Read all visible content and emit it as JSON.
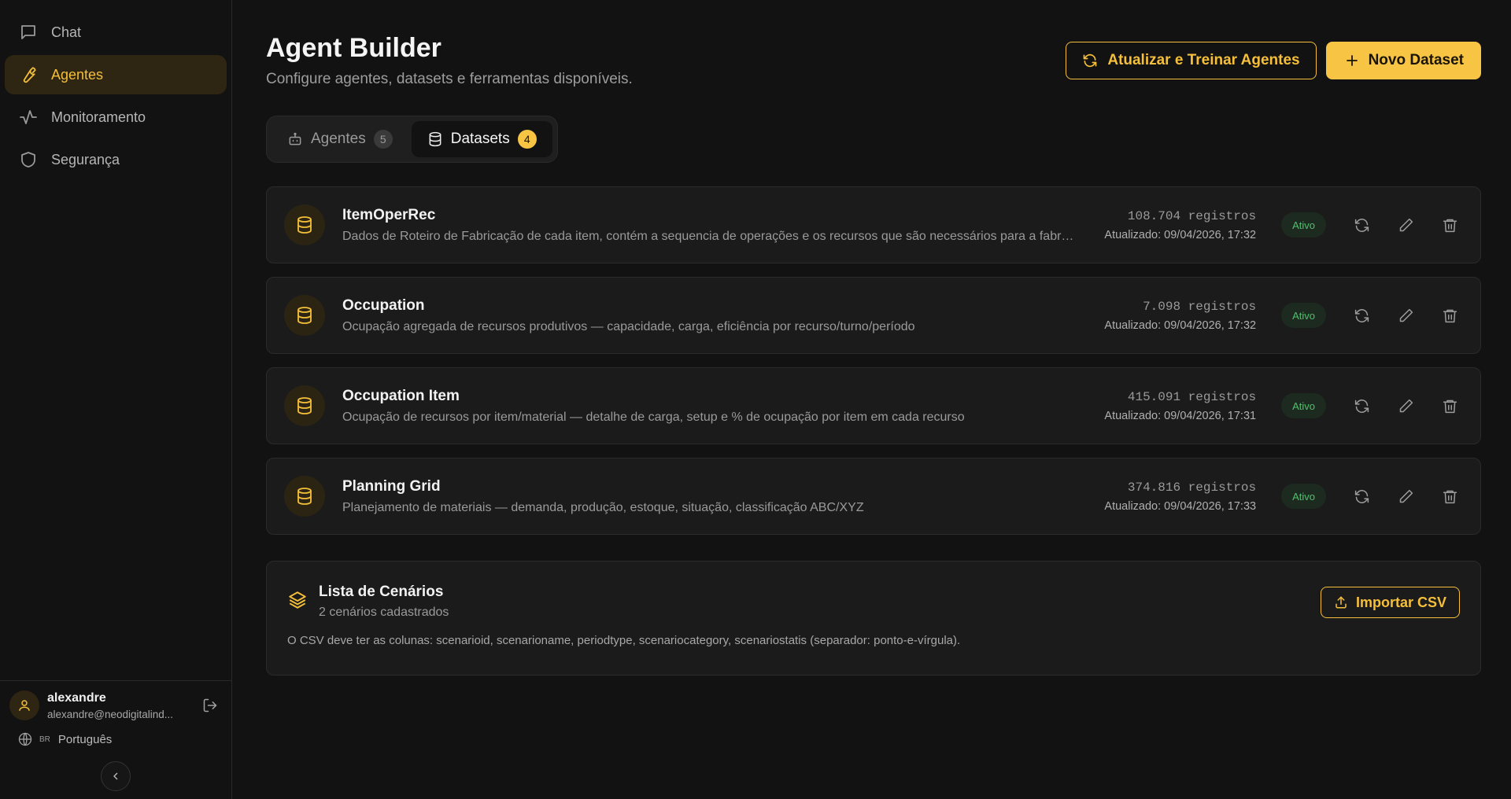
{
  "sidebar": {
    "nav": [
      {
        "label": "Chat",
        "icon": "chat-icon",
        "active": false
      },
      {
        "label": "Agentes",
        "icon": "wrench-icon",
        "active": true
      },
      {
        "label": "Monitoramento",
        "icon": "activity-icon",
        "active": false
      },
      {
        "label": "Segurança",
        "icon": "shield-icon",
        "active": false
      }
    ],
    "user": {
      "name": "alexandre",
      "email": "alexandre@neodigitalind..."
    },
    "language": {
      "code": "BR",
      "label": "Português"
    }
  },
  "header": {
    "title": "Agent Builder",
    "subtitle": "Configure agentes, datasets e ferramentas disponíveis.",
    "refresh_label": "Atualizar e Treinar Agentes",
    "new_dataset_label": "Novo Dataset"
  },
  "tabs": [
    {
      "label": "Agentes",
      "count": "5",
      "active": false
    },
    {
      "label": "Datasets",
      "count": "4",
      "active": true
    }
  ],
  "datasets": [
    {
      "name": "ItemOperRec",
      "description": "Dados de Roteiro de Fabricação de cada item, contém a sequencia de operações e os recursos que são necessários para a fabricação",
      "records": "108.704 registros",
      "updated": "Atualizado: 09/04/2026, 17:32",
      "status": "Ativo"
    },
    {
      "name": "Occupation",
      "description": "Ocupação agregada de recursos produtivos — capacidade, carga, eficiência por recurso/turno/período",
      "records": "7.098 registros",
      "updated": "Atualizado: 09/04/2026, 17:32",
      "status": "Ativo"
    },
    {
      "name": "Occupation Item",
      "description": "Ocupação de recursos por item/material — detalhe de carga, setup e % de ocupação por item em cada recurso",
      "records": "415.091 registros",
      "updated": "Atualizado: 09/04/2026, 17:31",
      "status": "Ativo"
    },
    {
      "name": "Planning Grid",
      "description": "Planejamento de materiais — demanda, produção, estoque, situação, classificação ABC/XYZ",
      "records": "374.816 registros",
      "updated": "Atualizado: 09/04/2026, 17:33",
      "status": "Ativo"
    }
  ],
  "scenarios": {
    "title": "Lista de Cenários",
    "subtitle": "2 cenários cadastrados",
    "import_label": "Importar CSV",
    "note": "O CSV deve ter as colunas: scenarioid, scenarioname, periodtype, scenariocategory, scenariostatis (separador: ponto-e-vírgula)."
  },
  "colors": {
    "accent": "#f5bf3a",
    "background": "#121212",
    "card": "#1b1b1b",
    "status_active": "#4ec26b"
  }
}
